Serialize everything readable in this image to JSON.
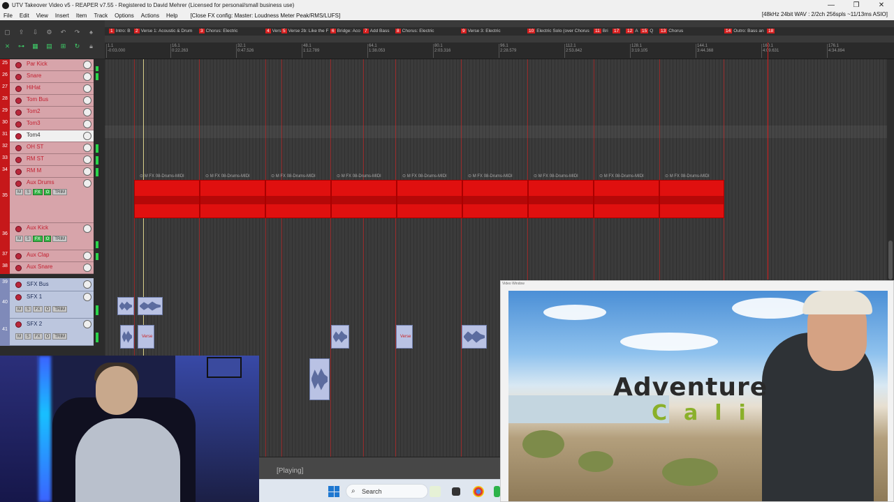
{
  "window": {
    "title": "UTV Takeover Video v5 - REAPER v7.55 - Registered to David Mehrer (Licensed for personal/small business use)",
    "controls": [
      "—",
      "❐",
      "✕"
    ]
  },
  "menubar": {
    "items": [
      "File",
      "Edit",
      "View",
      "Insert",
      "Item",
      "Track",
      "Options",
      "Actions",
      "Help"
    ],
    "fx_config": "[Close FX config: Master: Loudness Meter Peak/RMS/LUFS]",
    "audio_status": "[48kHz 24bit WAV : 2/2ch 256spls ~11/13ms ASIO]"
  },
  "regions": [
    {
      "num": "1",
      "label": "Intro: B"
    },
    {
      "num": "2",
      "label": "Verse 1: Acoustic & Drum"
    },
    {
      "num": "3",
      "label": "Chorus: Electric"
    },
    {
      "num": "4",
      "label": "Vers"
    },
    {
      "num": "5",
      "label": "Verse 2b: Like the F"
    },
    {
      "num": "6",
      "label": "Bridge: Aco"
    },
    {
      "num": "7",
      "label": "Add Bass"
    },
    {
      "num": "8",
      "label": "Chorus: Electric"
    },
    {
      "num": "9",
      "label": "Verse 3: Electric"
    },
    {
      "num": "10",
      "label": "Electric Solo (over Chorus"
    },
    {
      "num": "11",
      "label": "Bri"
    },
    {
      "num": "17",
      "label": ""
    },
    {
      "num": "12",
      "label": "A"
    },
    {
      "num": "15",
      "label": "Q"
    },
    {
      "num": "13",
      "label": "Chorus"
    },
    {
      "num": "14",
      "label": "Outro: Bass an"
    },
    {
      "num": "18",
      "label": ""
    }
  ],
  "ruler": [
    {
      "bar": "1.1",
      "time": "-0:03.000"
    },
    {
      "bar": "16.1",
      "time": "0:22.263"
    },
    {
      "bar": "32.1",
      "time": "0:47.526"
    },
    {
      "bar": "48.1",
      "time": "1:12.789"
    },
    {
      "bar": "64.1",
      "time": "1:38.053"
    },
    {
      "bar": "80.1",
      "time": "2:03.316"
    },
    {
      "bar": "96.1",
      "time": "2:28.579"
    },
    {
      "bar": "112.1",
      "time": "2:53.842"
    },
    {
      "bar": "128.1",
      "time": "3:19.105"
    },
    {
      "bar": "144.1",
      "time": "3:44.368"
    },
    {
      "bar": "160.1",
      "time": "4:09.631"
    },
    {
      "bar": "176.1",
      "time": "4:34.894"
    }
  ],
  "tracks": [
    {
      "num": "25",
      "name": "Par Kick"
    },
    {
      "num": "26",
      "name": "Snare"
    },
    {
      "num": "27",
      "name": "HiHat"
    },
    {
      "num": "28",
      "name": "Tom Bus"
    },
    {
      "num": "29",
      "name": "Tom2"
    },
    {
      "num": "30",
      "name": "Tom3"
    },
    {
      "num": "31",
      "name": "Tom4"
    },
    {
      "num": "32",
      "name": "OH ST"
    },
    {
      "num": "33",
      "name": "RM ST"
    },
    {
      "num": "34",
      "name": "RM M"
    },
    {
      "num": "35",
      "name": "Aux Drums"
    },
    {
      "num": "36",
      "name": "Aux Kick"
    },
    {
      "num": "37",
      "name": "Aux Clap"
    },
    {
      "num": "38",
      "name": "Aux Snare"
    },
    {
      "num": "39",
      "name": "SFX Bus"
    },
    {
      "num": "40",
      "name": "SFX 1"
    },
    {
      "num": "41",
      "name": "SFX 2"
    }
  ],
  "track_buttons": {
    "m": "M",
    "s": "S",
    "fx": "FX",
    "io": "O",
    "trim": "TRIM"
  },
  "midi_item_label": "08-Drums-MIDI",
  "midi_item_tags": "M FX",
  "sfx_clip_label": "Verse",
  "status": "[Playing]",
  "taskbar": {
    "search_placeholder": "Search"
  },
  "video": {
    "window_title": "Video Window",
    "title_line1": "Adventure",
    "title_line2": "Cali"
  }
}
